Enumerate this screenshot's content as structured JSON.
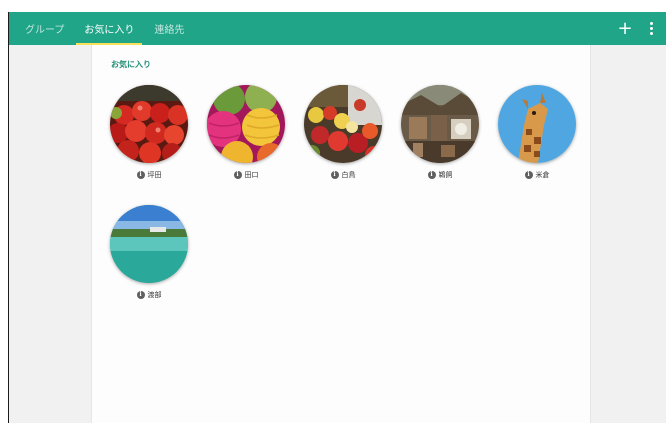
{
  "header": {
    "tabs": [
      {
        "label": "グループ",
        "active": false
      },
      {
        "label": "お気に入り",
        "active": true
      },
      {
        "label": "連絡先",
        "active": false
      }
    ],
    "icons": [
      "plus-icon",
      "more-vert-icon"
    ],
    "color": "#21a589",
    "accent": "#f6e25a"
  },
  "main": {
    "section_title": "お気に入り",
    "favorites": [
      {
        "name": "坪田",
        "image": "tomatoes"
      },
      {
        "name": "田口",
        "image": "yarn"
      },
      {
        "name": "白鳥",
        "image": "fruit-market"
      },
      {
        "name": "鵜飼",
        "image": "old-market"
      },
      {
        "name": "米倉",
        "image": "giraffe"
      },
      {
        "name": "渡部",
        "image": "beach"
      }
    ]
  }
}
